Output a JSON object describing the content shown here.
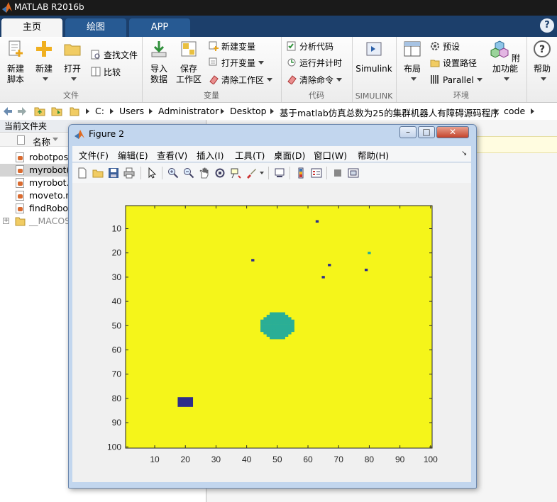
{
  "app": {
    "title": "MATLAB R2016b"
  },
  "ribbon_tabs": [
    {
      "label": "主页",
      "active": true
    },
    {
      "label": "绘图",
      "active": false
    },
    {
      "label": "APP",
      "active": false
    }
  ],
  "ribbon": {
    "file_section": {
      "label": "文件",
      "new_script": "新建\n脚本",
      "new": "新建",
      "open": "打开",
      "find_files": "查找文件",
      "compare": "比较"
    },
    "variable_section": {
      "label": "变量",
      "import": "导入\n数据",
      "save_ws": "保存\n工作区",
      "new_var": "新建变量",
      "open_var": "打开变量",
      "clear_ws": "清除工作区"
    },
    "code_section": {
      "label": "代码",
      "analyze": "分析代码",
      "run_time": "运行并计时",
      "clear_cmd": "清除命令"
    },
    "simulink_section": {
      "label": "SIMULINK",
      "simulink": "Simulink"
    },
    "env_section": {
      "label": "环境",
      "layout": "布局",
      "prefs": "预设",
      "set_path": "设置路径",
      "parallel": "Parallel",
      "addons": "附加功能"
    },
    "help": "帮助"
  },
  "address": {
    "crumbs": [
      "C:",
      "Users",
      "Administrator",
      "Desktop",
      "基于matlab仿真总数为25的集群机器人有障碍源码程序",
      "code"
    ]
  },
  "left_panel": {
    "title": "当前文件夹",
    "col_header": "名称",
    "files": [
      {
        "name": "robotpos",
        "selected": false
      },
      {
        "name": "myrobot(",
        "selected": true
      },
      {
        "name": "myrobot.",
        "selected": false
      },
      {
        "name": "moveto.n",
        "selected": false
      },
      {
        "name": "findRobo",
        "selected": false
      }
    ],
    "folder": "__MACOS"
  },
  "figure": {
    "title": "Figure 2",
    "menu": [
      "文件(F)",
      "编辑(E)",
      "查看(V)",
      "插入(I)",
      "工具(T)",
      "桌面(D)",
      "窗口(W)",
      "帮助(H)"
    ]
  },
  "chart_data": {
    "type": "heatmap",
    "xlim": [
      0.5,
      100.5
    ],
    "ylim": [
      0.5,
      100.5
    ],
    "y_reversed": true,
    "xticks": [
      10,
      20,
      30,
      40,
      50,
      60,
      70,
      80,
      90,
      100
    ],
    "yticks": [
      10,
      20,
      30,
      40,
      50,
      60,
      70,
      80,
      90,
      100
    ],
    "grid": false,
    "colors": {
      "background": "#f5f51a",
      "obstacle": "#2e2e8a",
      "robot": "#2aae96"
    },
    "background_value": 0,
    "cells": [
      {
        "x": 63,
        "y": 7,
        "w": 1,
        "h": 1,
        "kind": "obstacle"
      },
      {
        "x": 80,
        "y": 20,
        "w": 1,
        "h": 1,
        "kind": "robot"
      },
      {
        "x": 42,
        "y": 23,
        "w": 1,
        "h": 1,
        "kind": "obstacle"
      },
      {
        "x": 67,
        "y": 25,
        "w": 1,
        "h": 1,
        "kind": "obstacle"
      },
      {
        "x": 79,
        "y": 27,
        "w": 1,
        "h": 1,
        "kind": "obstacle"
      },
      {
        "x": 65,
        "y": 30,
        "w": 1,
        "h": 1,
        "kind": "obstacle"
      },
      {
        "x": 18,
        "y": 80,
        "w": 5,
        "h": 4,
        "kind": "obstacle"
      }
    ],
    "cluster": {
      "cx": 50,
      "cy": 50,
      "rx": 5,
      "ry": 5,
      "kind": "robot"
    }
  }
}
